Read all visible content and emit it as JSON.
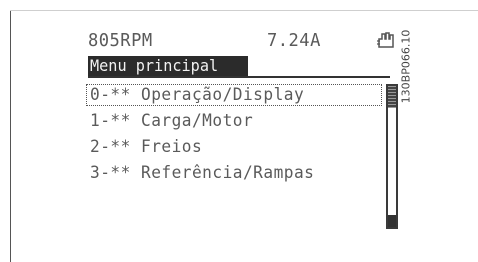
{
  "status": {
    "speed": "805RPM",
    "current": "7.24A",
    "hand_icon": "hand-hold-icon"
  },
  "menu": {
    "title": "Menu principal",
    "items": [
      {
        "label": "0-** Operação/Display"
      },
      {
        "label": "1-** Carga/Motor"
      },
      {
        "label": "2-** Freios"
      },
      {
        "label": "3-** Referência/Rampas"
      }
    ],
    "selected_index": 0
  },
  "figure_code": "130BP066.10",
  "colors": {
    "lcd_text": "#5a5a5a",
    "title_bg": "#2b2b2b"
  }
}
